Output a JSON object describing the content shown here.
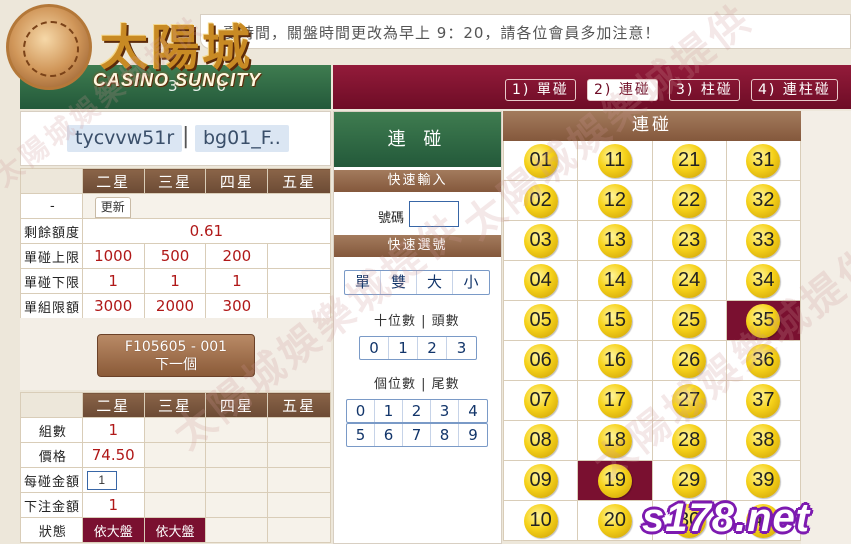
{
  "marquee": {
    "text": "夏時間，關盤時間更改為早上 9：20，請各位會員多加注意！"
  },
  "logo": {
    "cn": "太陽城",
    "en": "CASINO SUNCITY"
  },
  "header": {
    "period": "3 3 0"
  },
  "modes": [
    {
      "label": "1) 單碰",
      "active": false
    },
    {
      "label": "2) 連碰",
      "active": true
    },
    {
      "label": "3) 柱碰",
      "active": false
    },
    {
      "label": "4) 連柱碰",
      "active": false
    }
  ],
  "user": {
    "account": "tycvvw51r",
    "separator": "|",
    "group": "bg01_F.."
  },
  "limits": {
    "columns": [
      "二星",
      "三星",
      "四星",
      "五星"
    ],
    "dash": "-",
    "update_label": "更新",
    "rows": [
      {
        "label": "剩餘額度",
        "values": [
          "0.61"
        ]
      },
      {
        "label": "單碰上限",
        "values": [
          "1000",
          "500",
          "200",
          ""
        ]
      },
      {
        "label": "單碰下限",
        "values": [
          "1",
          "1",
          "1",
          ""
        ]
      },
      {
        "label": "單組限額",
        "values": [
          "3000",
          "2000",
          "300",
          ""
        ]
      }
    ]
  },
  "ticket": {
    "code": "F105605 - 001",
    "next_label": "下一個"
  },
  "bet": {
    "columns": [
      "二星",
      "三星",
      "四星",
      "五星"
    ],
    "rows": [
      {
        "label": "組數",
        "value": "1"
      },
      {
        "label": "價格",
        "value": "74.50"
      },
      {
        "label": "每碰金額",
        "input": "1"
      },
      {
        "label": "下注金額",
        "value": "1"
      },
      {
        "label": "狀態",
        "status": [
          "依大盤",
          "依大盤"
        ]
      }
    ]
  },
  "middle": {
    "title": "連 碰",
    "quick_input": "快速輸入",
    "number_label": "號碼",
    "quick_select": "快速選號",
    "parity_buttons": [
      "單",
      "雙",
      "大",
      "小"
    ],
    "tens_label": "十位數 | 頭數",
    "tens_buttons": [
      "0",
      "1",
      "2",
      "3"
    ],
    "units_label": "個位數 | 尾數",
    "units_row1": [
      "0",
      "1",
      "2",
      "3",
      "4"
    ],
    "units_row2": [
      "5",
      "6",
      "7",
      "8",
      "9"
    ]
  },
  "grid": {
    "title": "連碰",
    "numbers": [
      "01",
      "11",
      "21",
      "31",
      "02",
      "12",
      "22",
      "32",
      "03",
      "13",
      "23",
      "33",
      "04",
      "14",
      "24",
      "34",
      "05",
      "15",
      "25",
      "35",
      "06",
      "16",
      "26",
      "36",
      "07",
      "17",
      "27",
      "37",
      "08",
      "18",
      "28",
      "38",
      "09",
      "19",
      "29",
      "39",
      "10",
      "20",
      "30",
      "40"
    ],
    "selected": [
      "35",
      "19"
    ]
  },
  "watermark": "太陽城娛樂城提供",
  "site_badge": "s178.net",
  "colors": {
    "accent_red": "#7a1030",
    "green": "#23593a",
    "brown": "#84583c",
    "ball": "#f6d21a"
  }
}
